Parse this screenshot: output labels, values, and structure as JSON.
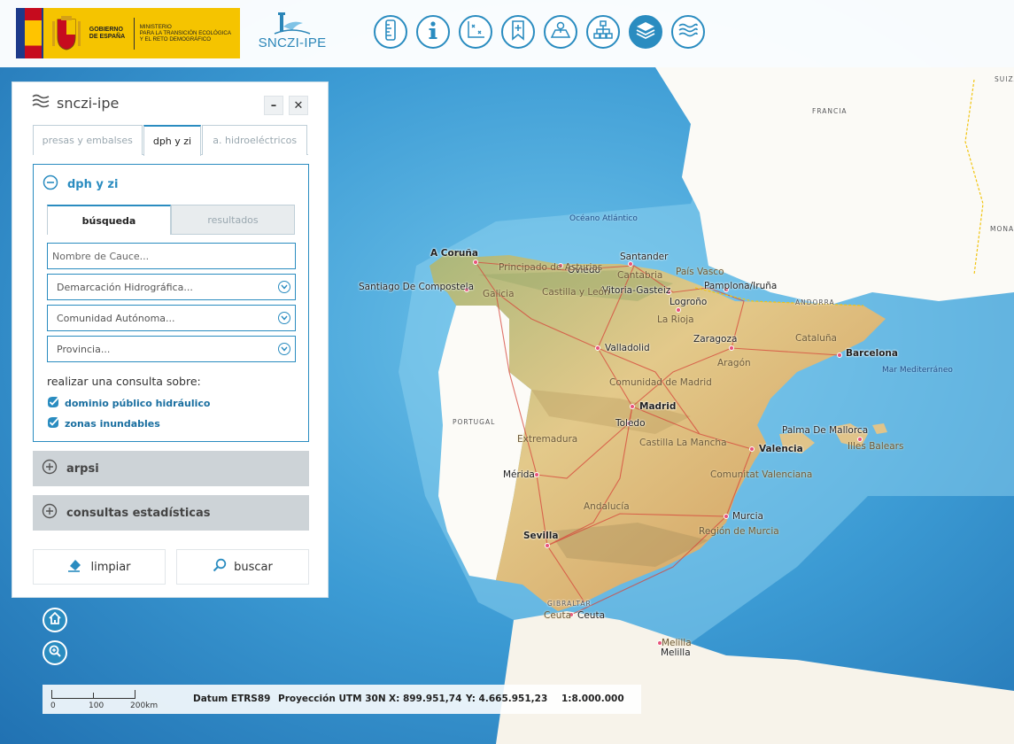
{
  "header": {
    "gov_line1": "GOBIERNO",
    "gov_line2": "DE ESPAÑA",
    "ministry_line1": "MINISTERIO",
    "ministry_line2": "PARA LA TRANSICIÓN ECOLÓGICA",
    "ministry_line3": "Y EL RETO DEMOGRÁFICO",
    "app_logo": "SNCZI-IPE",
    "toolbar": [
      {
        "icon": "ruler-icon"
      },
      {
        "icon": "info-icon"
      },
      {
        "icon": "coordinates-icon"
      },
      {
        "icon": "bookmark-add-icon"
      },
      {
        "icon": "map-location-icon"
      },
      {
        "icon": "hierarchy-icon"
      },
      {
        "icon": "layers-icon"
      },
      {
        "icon": "waves-icon"
      }
    ],
    "accent": "#2a8cc0"
  },
  "panel": {
    "title": "snczi-ipe",
    "minimize": "–",
    "close": "✕",
    "tabs": [
      "presas y embalses",
      "dph y zi",
      "a. hidroeléctricos"
    ],
    "active_tab": "dph y zi",
    "section": {
      "title": "dph y zi",
      "subtabs": [
        "búsqueda",
        "resultados"
      ],
      "cauce_placeholder": "Nombre de Cauce...",
      "demarcacion": "Demarcación Hidrográfica...",
      "comunidad": "Comunidad Autónoma...",
      "provincia": "Provincia...",
      "query_label": "realizar una consulta sobre:",
      "checks": [
        "dominio público hidráulico",
        "zonas inundables"
      ]
    },
    "collapsed_sections": [
      "arpsi",
      "consultas estadísticas"
    ],
    "buttons": {
      "clear": "limpiar",
      "search": "buscar"
    }
  },
  "map": {
    "cities": [
      {
        "name": "A Coruña"
      },
      {
        "name": "Santander"
      },
      {
        "name": "Oviedo"
      },
      {
        "name": "Vitoria-Gasteiz"
      },
      {
        "name": "Pamplona/Iruña"
      },
      {
        "name": "Santiago De Compostela"
      },
      {
        "name": "Logroño"
      },
      {
        "name": "Valladolid"
      },
      {
        "name": "Zaragoza"
      },
      {
        "name": "Barcelona"
      },
      {
        "name": "Madrid"
      },
      {
        "name": "Toledo"
      },
      {
        "name": "Valencia"
      },
      {
        "name": "Palma De Mallorca"
      },
      {
        "name": "Mérida"
      },
      {
        "name": "Murcia"
      },
      {
        "name": "Sevilla"
      },
      {
        "name": "Ceuta"
      },
      {
        "name": "Melilla"
      }
    ],
    "regions": [
      "Principado de Asturias",
      "Cantabria",
      "País Vasco",
      "Galicia",
      "Castilla y León",
      "La Rioja",
      "Cataluña",
      "Aragón",
      "Comunidad de Madrid",
      "Extremadura",
      "Castilla La Mancha",
      "Comunitat Valenciana",
      "Andalucía",
      "Región de Murcia",
      "Illes Balears",
      "Ceuta",
      "Melilla"
    ],
    "countries": [
      "FRANCIA",
      "PORTUGAL",
      "ANDORRA",
      "GIBRALTAR",
      "SUIZA",
      "MONACO"
    ],
    "seas": [
      "Océano Atlántico",
      "Mar Mediterráneo"
    ]
  },
  "status": {
    "scale_labels": [
      "0",
      "100",
      "200km"
    ],
    "datum": "Datum ETRS89",
    "projection": "Proyección UTM 30N",
    "x": "X: 899.951,74",
    "y": "Y: 4.665.951,23",
    "ratio": "1:8.000.000"
  }
}
